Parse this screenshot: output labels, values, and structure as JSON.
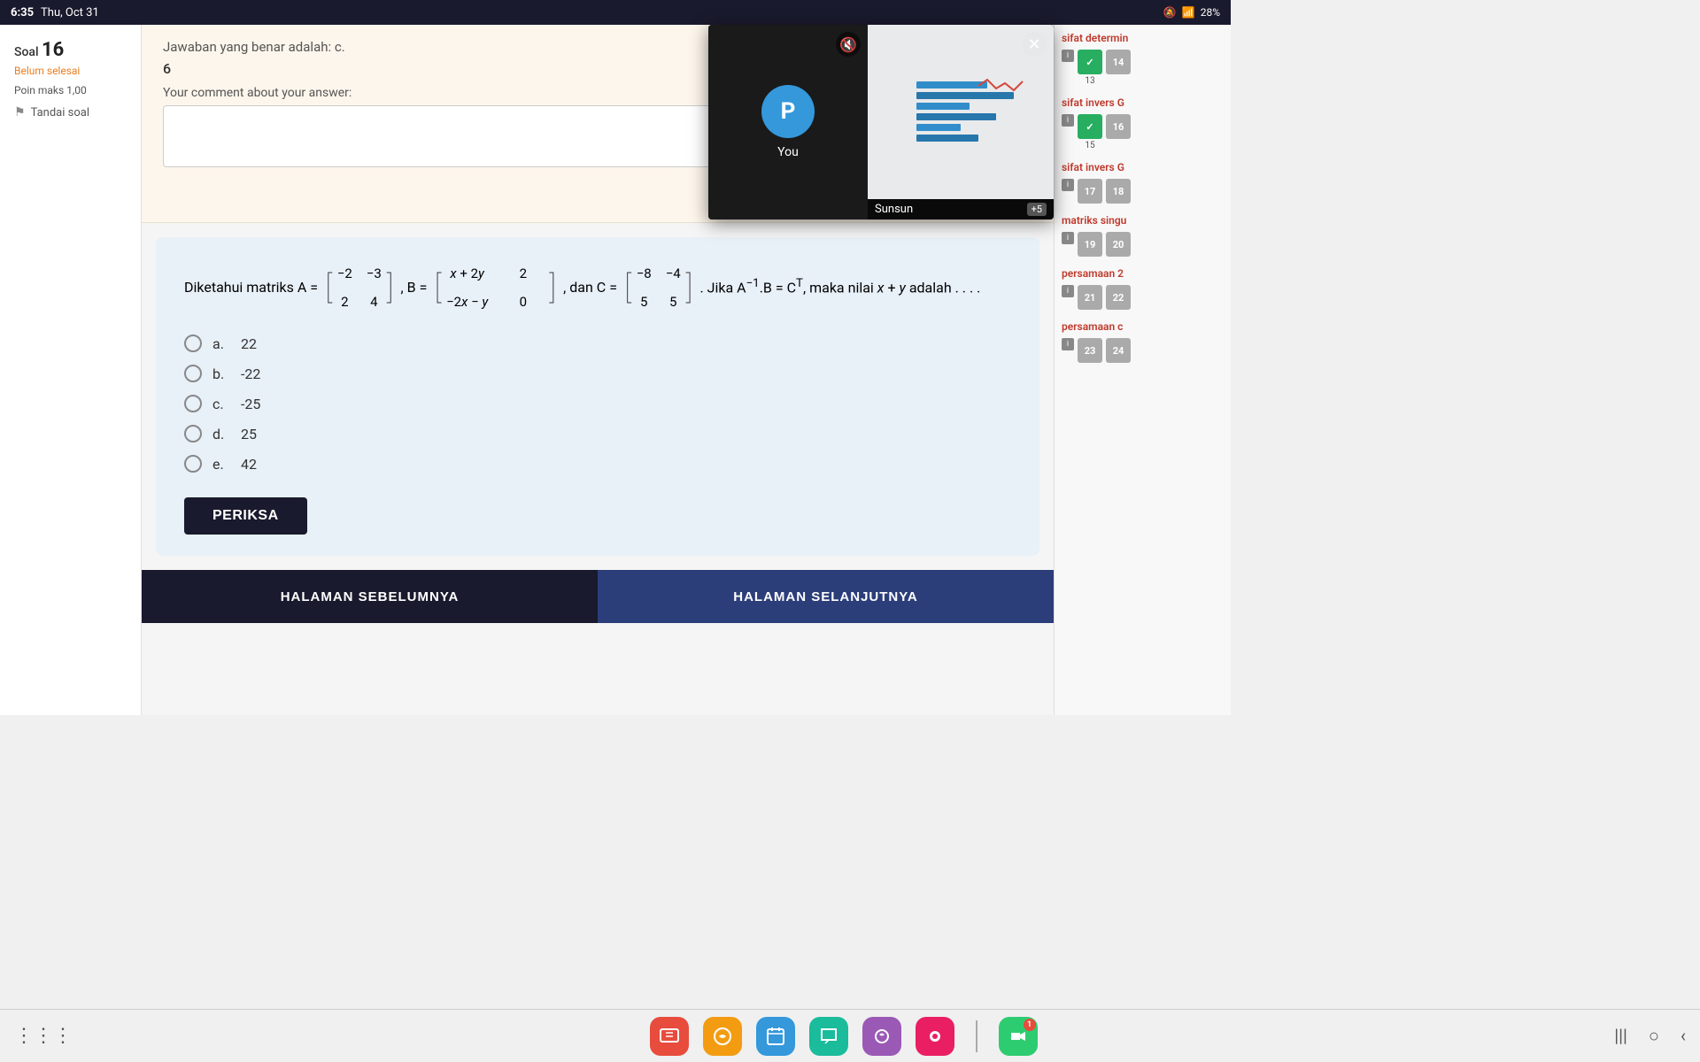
{
  "status_bar": {
    "time": "6:35",
    "date": "Thu, Oct 31",
    "battery": "28%"
  },
  "prev_answer": {
    "label": "Jawaban yang benar adalah: c.",
    "value": "6",
    "comment_label": "Your comment about your answer:",
    "comment_placeholder": ""
  },
  "soal": {
    "label": "Soal",
    "number": "16",
    "status": "Belum selesai",
    "poin_label": "Poin maks 1,00",
    "tandai_label": "Tandai soal"
  },
  "question": {
    "text_intro": "Diketahui matriks A =",
    "matrix_A": [
      "-2",
      "-3",
      "2",
      "4"
    ],
    "sep1": ", B =",
    "matrix_B": [
      "x + 2y",
      "2",
      "-2x - y",
      "0"
    ],
    "sep2": ", dan C =",
    "matrix_C": [
      "-8",
      "-4",
      "5",
      "5"
    ],
    "text_end": ". Jika A⁻¹.B = Cᵀ, maka nilai x + y adalah . . . .",
    "options": [
      {
        "key": "a",
        "value": "22"
      },
      {
        "key": "b",
        "value": "-22"
      },
      {
        "key": "c",
        "value": "-25"
      },
      {
        "key": "d",
        "value": "25"
      },
      {
        "key": "e",
        "value": "42"
      }
    ],
    "periksa_label": "PERIKSA"
  },
  "navigation": {
    "prev_label": "HALAMAN SEBELUMNYA",
    "next_label": "HALAMAN SELANJUTNYA"
  },
  "right_sidebar": {
    "topics": [
      {
        "title": "sifat determin",
        "items": [
          {
            "id": "i",
            "number": ""
          },
          {
            "id": "13",
            "number": "13",
            "checked": true
          },
          {
            "id": "14",
            "number": "14",
            "partial": true
          }
        ]
      },
      {
        "title": "sifat invers G",
        "items": [
          {
            "id": "i",
            "number": ""
          },
          {
            "id": "15",
            "number": "15",
            "checked": true
          },
          {
            "id": "16",
            "number": "16",
            "partial": true
          }
        ]
      },
      {
        "title": "sifat invers G",
        "items": [
          {
            "id": "i",
            "number": ""
          },
          {
            "id": "17",
            "number": "17"
          },
          {
            "id": "18",
            "number": "18",
            "partial": true
          }
        ]
      },
      {
        "title": "matriks singu",
        "items": [
          {
            "id": "i",
            "number": ""
          },
          {
            "id": "19",
            "number": "19"
          },
          {
            "id": "20",
            "number": "20"
          }
        ]
      },
      {
        "title": "persamaan 2",
        "items": [
          {
            "id": "i",
            "number": ""
          },
          {
            "id": "21",
            "number": "21"
          },
          {
            "id": "22",
            "number": "22"
          }
        ]
      },
      {
        "title": "persamaan c",
        "items": [
          {
            "id": "i",
            "number": ""
          },
          {
            "id": "23",
            "number": "23"
          },
          {
            "id": "24",
            "number": "24"
          }
        ]
      }
    ]
  },
  "video_call": {
    "user_initial": "P",
    "user_name": "You",
    "other_name": "Sunsun",
    "plus_count": "+5"
  },
  "taskbar": {
    "apps": [
      {
        "name": "grid-menu",
        "color": "grey",
        "icon": "⋮⋮⋮"
      },
      {
        "name": "google-classroom",
        "color": "red",
        "icon": "🎓"
      },
      {
        "name": "hangouts",
        "color": "yellow",
        "icon": "💬"
      },
      {
        "name": "calendar",
        "color": "blue",
        "icon": "📅"
      },
      {
        "name": "chat",
        "color": "teal",
        "icon": "💬"
      },
      {
        "name": "skype-like",
        "color": "purple",
        "icon": "📞"
      },
      {
        "name": "screen-recorder",
        "color": "pink",
        "icon": "⏺"
      },
      {
        "name": "meet",
        "color": "green",
        "icon": "📹",
        "badge": "1"
      }
    ],
    "nav": [
      "|||",
      "○",
      "‹"
    ]
  },
  "colors": {
    "dark_navy": "#1a1a2e",
    "medium_navy": "#2c3e7a",
    "accent_orange": "#e67e22",
    "correct_green": "#27ae60",
    "topic_red": "#c0392b"
  }
}
